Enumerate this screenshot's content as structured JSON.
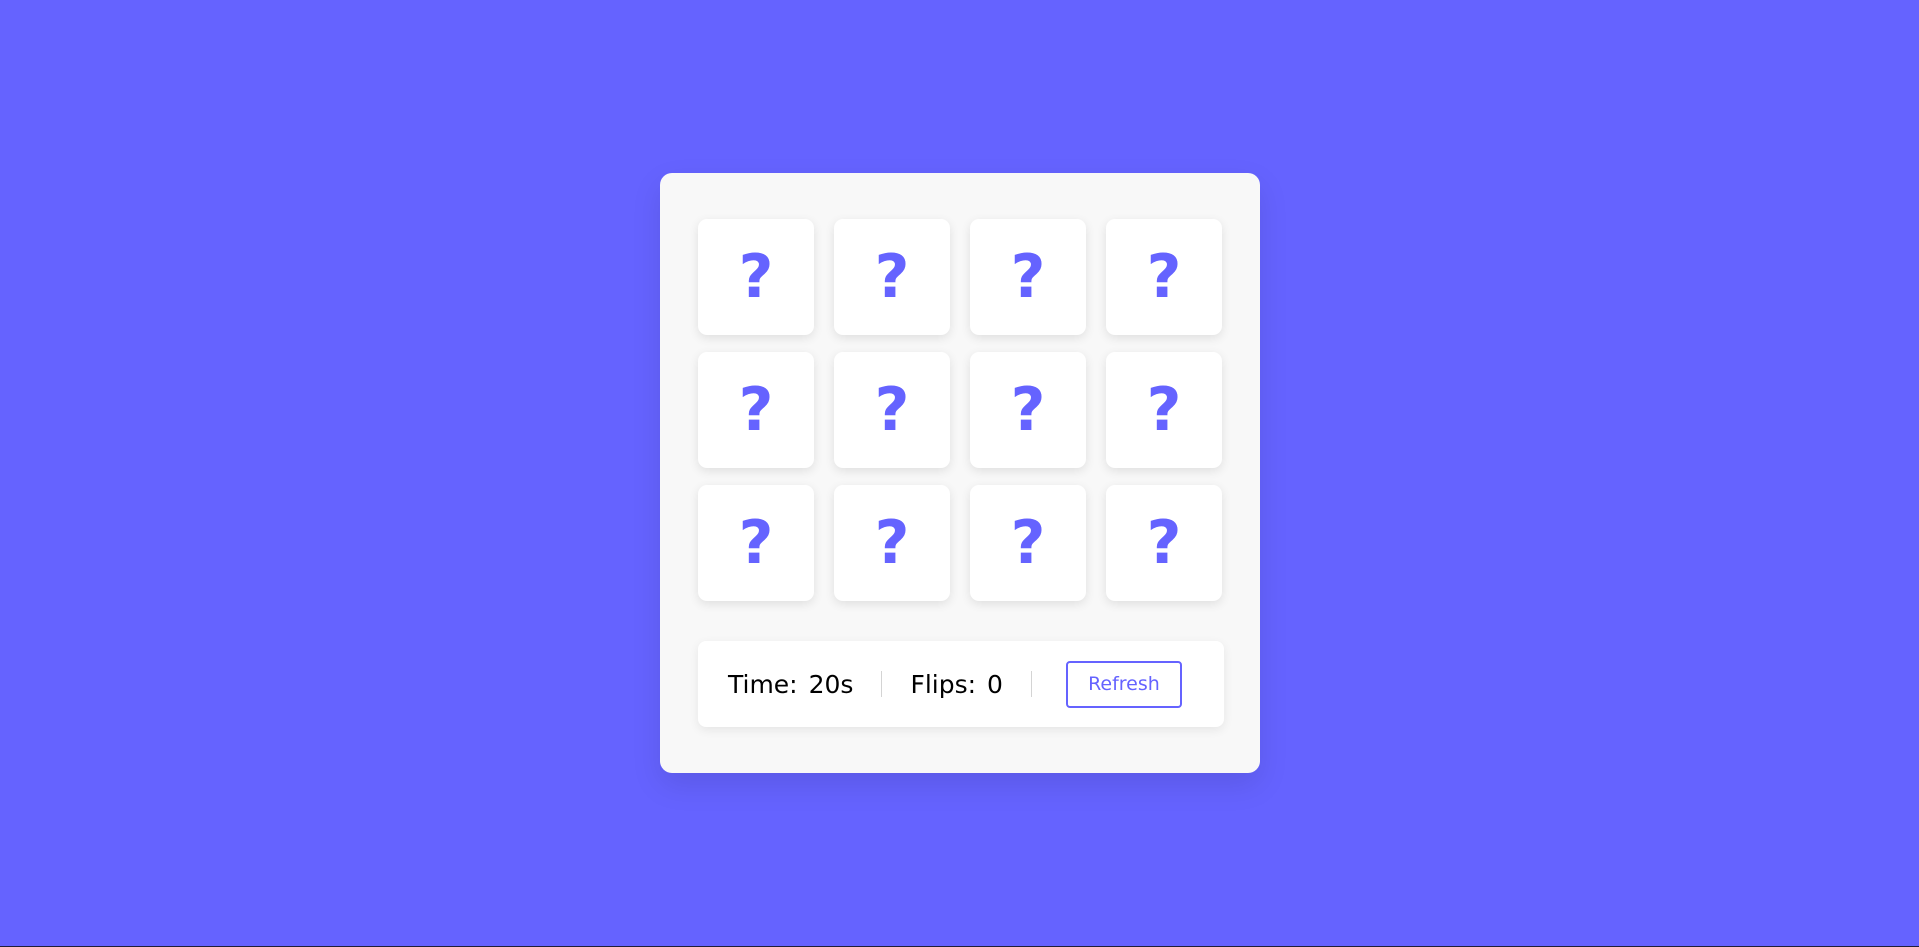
{
  "colors": {
    "background": "#6563ff",
    "panel": "#f8f8f8",
    "card": "#ffffff",
    "accent": "#6563ff"
  },
  "cards": [
    {
      "symbol": "?"
    },
    {
      "symbol": "?"
    },
    {
      "symbol": "?"
    },
    {
      "symbol": "?"
    },
    {
      "symbol": "?"
    },
    {
      "symbol": "?"
    },
    {
      "symbol": "?"
    },
    {
      "symbol": "?"
    },
    {
      "symbol": "?"
    },
    {
      "symbol": "?"
    },
    {
      "symbol": "?"
    },
    {
      "symbol": "?"
    }
  ],
  "details": {
    "time_label": "Time:",
    "time_value": "20s",
    "flips_label": "Flips:",
    "flips_value": "0",
    "refresh_label": "Refresh"
  }
}
